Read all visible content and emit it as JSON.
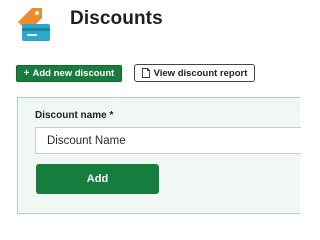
{
  "header": {
    "title": "Discounts",
    "logo_icon": "discount-tag-icon"
  },
  "toolbar": {
    "add_new_label": "Add new discount",
    "add_new_icon": "plus-icon",
    "report_label": "View discount report",
    "report_icon": "document-icon"
  },
  "form": {
    "name_label": "Discount name *",
    "name_placeholder": "Discount Name",
    "name_value": "",
    "submit_label": "Add"
  },
  "colors": {
    "brand_green": "#177d3f",
    "panel_bg": "#f1f8f3",
    "panel_border": "#a7d6b6",
    "logo_orange": "#f08a2b",
    "logo_blue": "#2aa9c9"
  }
}
